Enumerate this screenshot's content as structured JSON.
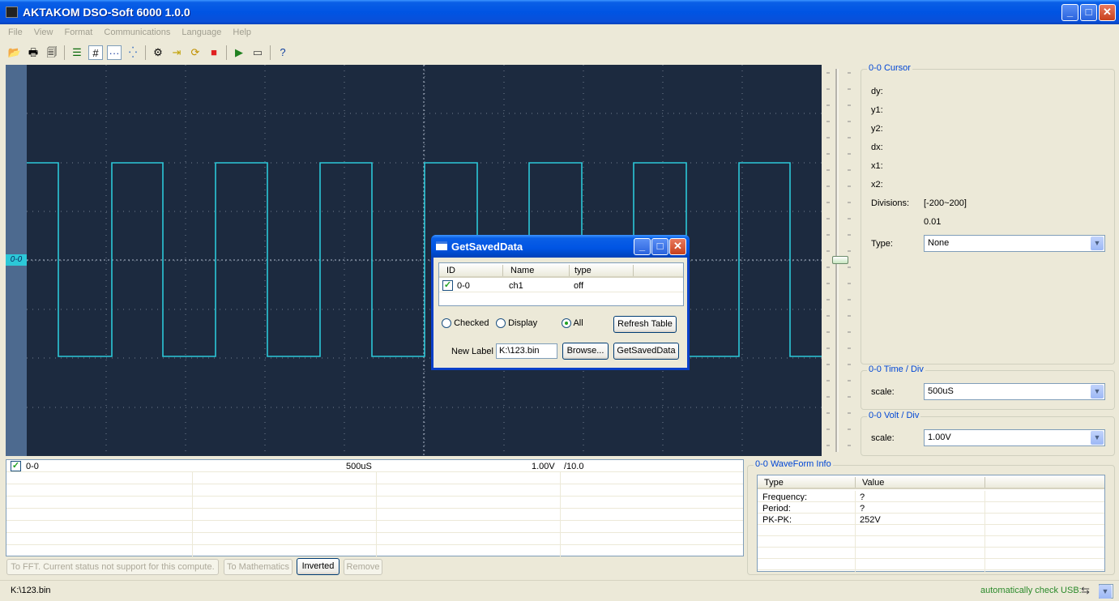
{
  "window": {
    "title": "AKTAKOM DSO-Soft 6000 1.0.0",
    "min_icon": "minimize-icon",
    "max_icon": "maximize-icon",
    "close_icon": "close-icon"
  },
  "menu": [
    "File",
    "View",
    "Format",
    "Communications",
    "Language",
    "Help"
  ],
  "toolbar": [
    "open-icon",
    "print-icon",
    "print-preview-icon",
    "list-icon",
    "grid-icon",
    "line-icon",
    "dots-icon",
    "settings-icon",
    "import-icon",
    "refresh-icon",
    "stop-icon",
    "export-icon",
    "screen-icon",
    "help-icon"
  ],
  "scope": {
    "channel_tag": "0-0",
    "trace_color": "#2cc8d8",
    "background": "#1c2a3f"
  },
  "cursor_panel": {
    "title": "0-0 Cursor",
    "labels": [
      "dy:",
      "y1:",
      "y2:",
      "dx:",
      "x1:",
      "x2:"
    ],
    "divisions_label": "Divisions:",
    "divisions_range": "[-200~200]",
    "divisions_value": "0.01",
    "type_label": "Type:",
    "type_value": "None"
  },
  "time_panel": {
    "title": "0-0 Time / Div",
    "scale_label": "scale:",
    "scale_value": "500uS"
  },
  "volt_panel": {
    "title": "0-0 Volt / Div",
    "scale_label": "scale:",
    "scale_value": "1.00V"
  },
  "channel_grid": {
    "row": {
      "id": "0-0",
      "time": "500uS",
      "volt": "1.00V",
      "div": "/10.0"
    }
  },
  "buttons": {
    "fft": "To FFT. Current status not support for this compute.",
    "math": "To Mathematics",
    "inverted": "Inverted",
    "remove": "Remove"
  },
  "waveform_info": {
    "title": "0-0 WaveForm Info",
    "headers": [
      "Type",
      "Value"
    ],
    "rows": [
      {
        "type": "Frequency:",
        "value": "?"
      },
      {
        "type": "Period:",
        "value": "?"
      },
      {
        "type": "PK-PK:",
        "value": "252V"
      }
    ]
  },
  "status": {
    "file": "K:\\123.bin",
    "usb_text": "automatically check USB:"
  },
  "dialog": {
    "title": "GetSavedData",
    "headers": [
      "ID",
      "Name",
      "type"
    ],
    "row": {
      "id": "0-0",
      "name": "ch1",
      "type": "off"
    },
    "radio_checked": "Checked",
    "radio_display": "Display",
    "radio_all": "All",
    "refresh": "Refresh Table",
    "new_label": "New Label",
    "file_value": "K:\\123.bin",
    "browse": "Browse...",
    "get": "GetSavedData"
  }
}
